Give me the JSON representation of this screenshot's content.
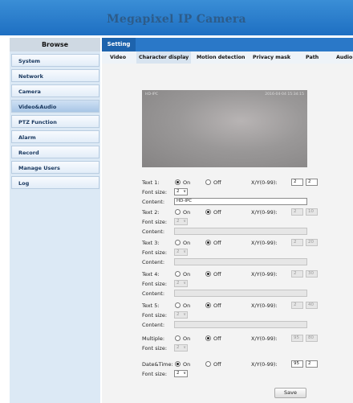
{
  "header": {
    "title": "Megapixel IP Camera"
  },
  "sidebar": {
    "browse_label": "Browse",
    "items": [
      {
        "label": "System"
      },
      {
        "label": "Network"
      },
      {
        "label": "Camera"
      },
      {
        "label": "Video&Audio",
        "active": true
      },
      {
        "label": "PTZ Function"
      },
      {
        "label": "Alarm"
      },
      {
        "label": "Record"
      },
      {
        "label": "Manage Users"
      },
      {
        "label": "Log"
      }
    ]
  },
  "topbar": {
    "setting_label": "Setting"
  },
  "tabs": [
    "Video",
    "Character display",
    "Motion detection",
    "Privacy mask",
    "Path",
    "Audio"
  ],
  "active_tab": "Character display",
  "preview": {
    "overlay_text": "HD-IPC",
    "timestamp": "2016-04-04  15:34:15"
  },
  "form": {
    "font_size_label": "Font size:",
    "content_label": "Content:",
    "xy_label": "X/Y(0-99):",
    "on_label": "On",
    "off_label": "Off",
    "rows": [
      {
        "label": "Text 1:",
        "state": "On",
        "x": "2",
        "y": "2",
        "font_size": "2",
        "content": "HD-IPC"
      },
      {
        "label": "Text 2:",
        "state": "Off",
        "x": "2",
        "y": "10",
        "font_size": "2",
        "content": ""
      },
      {
        "label": "Text 3:",
        "state": "Off",
        "x": "2",
        "y": "20",
        "font_size": "2",
        "content": ""
      },
      {
        "label": "Text 4:",
        "state": "Off",
        "x": "2",
        "y": "30",
        "font_size": "2",
        "content": ""
      },
      {
        "label": "Text 5:",
        "state": "Off",
        "x": "2",
        "y": "40",
        "font_size": "2",
        "content": ""
      },
      {
        "label": "Multiple:",
        "state": "Off",
        "x": "95",
        "y": "80",
        "font_size": "2"
      },
      {
        "label": "Date&Time:",
        "state": "On",
        "x": "95",
        "y": "2",
        "font_size": "2"
      }
    ],
    "save_label": "Save"
  }
}
